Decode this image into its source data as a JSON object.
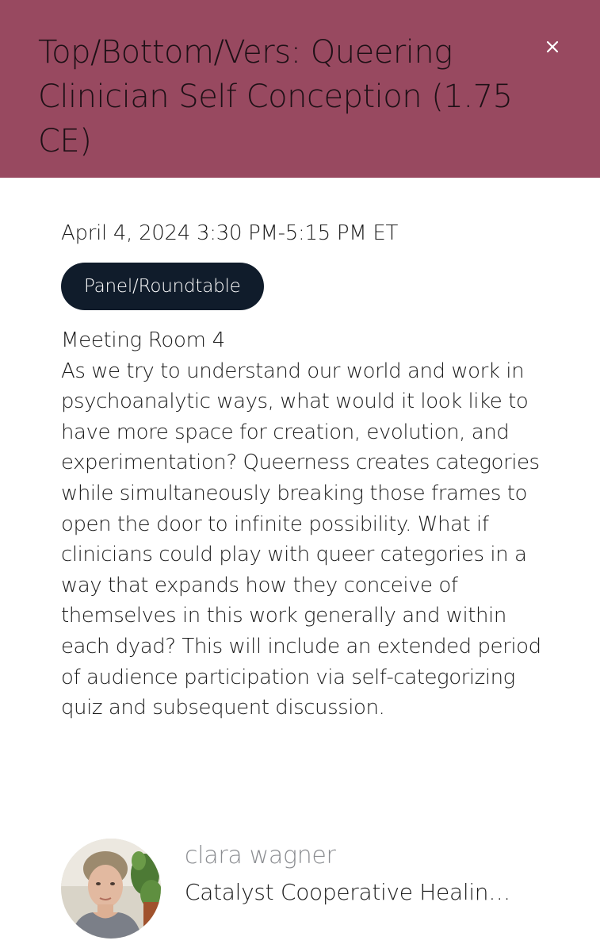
{
  "session": {
    "title": "Top/Bottom/Vers: Queering Clinician Self Conception (1.75 CE)",
    "datetime": "April 4, 2024 3:30 PM-5:15 PM ET",
    "format_badge": "Panel/Roundtable",
    "location": "Meeting Room 4",
    "description": "As we try to understand our world and work in psychoanalytic ways, what would it look like to have more space for creation, evolution, and experimentation? Queerness creates categories while simultaneously breaking those frames to open the door to infinite possibility. What if clinicians could play with queer categories in a way that expands how they conceive of themselves in this work generally and within each dyad? This will include an extended period of audience participation via self-categorizing quiz and subsequent discussion."
  },
  "speaker": {
    "name": "clara wagner",
    "organization": "Catalyst Cooperative Healing Arts",
    "avatar_icon": "person-photo-icon"
  },
  "colors": {
    "header_bg": "#984960",
    "badge_bg": "#101c2b",
    "speaker_name": "#8a8c90"
  }
}
